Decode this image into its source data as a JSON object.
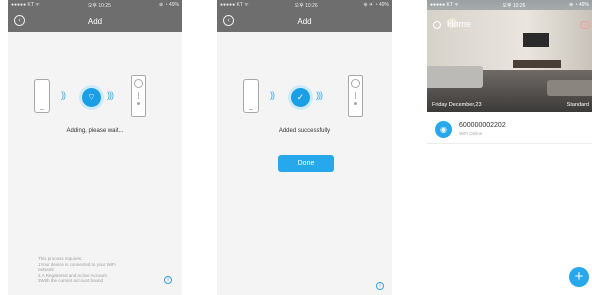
{
  "screen1": {
    "status": {
      "carrier": "●●●●● KT ᯤ",
      "time": "오후 10:25",
      "battery": "⊕ ◔ 49%"
    },
    "nav": {
      "title": "Add"
    },
    "message": "Adding, please wait...",
    "requirements": [
      "This process requires:",
      "1Your device is connected to your WiFi",
      "network",
      "2.A Registered and Active Account",
      "3With the current account bound"
    ]
  },
  "screen2": {
    "status": {
      "carrier": "●●●●● KT ᯤ",
      "time": "오후 10:26",
      "battery": "⊕ ✈ ◔ 49%"
    },
    "nav": {
      "title": "Add"
    },
    "message": "Added successfully",
    "done_label": "Done"
  },
  "screen3": {
    "status": {
      "carrier": "●●●●● KT ᯤ",
      "time": "오후 10:26",
      "battery": "⊕ ◔ 49%"
    },
    "title": "Home",
    "date": "Friday December,23",
    "mode": "Standard",
    "device": {
      "name": "600000002202",
      "status": "WiFi Online"
    },
    "fab_label": "+"
  },
  "colors": {
    "accent": "#27a8ec",
    "navbar": "#6e6e6e"
  },
  "icons": [
    "back-icon",
    "wifi-icon",
    "check-icon",
    "info-icon",
    "menu-icon",
    "camera-icon",
    "plus-icon"
  ]
}
